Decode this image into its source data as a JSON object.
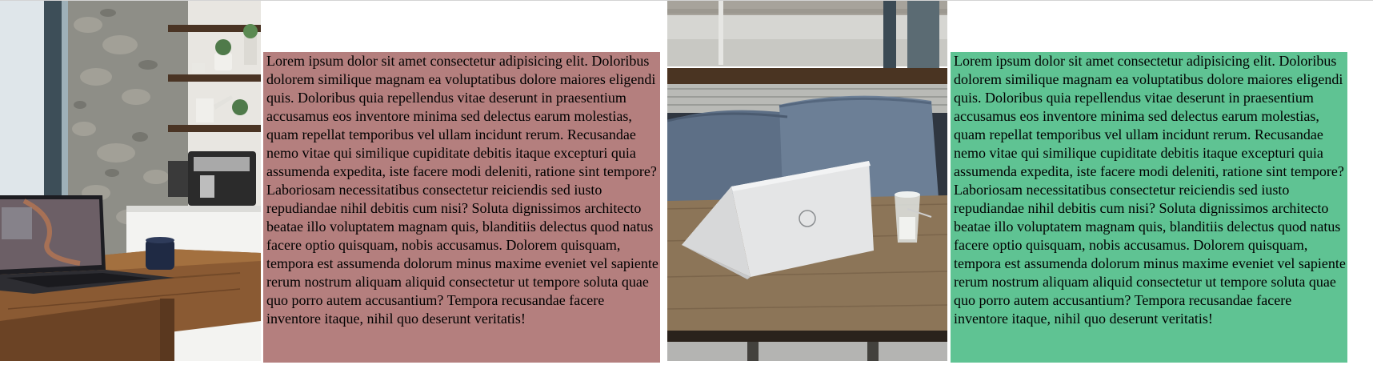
{
  "colors": {
    "block_1_background": "#b47f7e",
    "block_2_background": "#5fc393",
    "top_rule": "#d4d4d4"
  },
  "images": [
    {
      "description_icon": "laptop-coffee-kitchen-photo"
    },
    {
      "description_icon": "laptop-cafe-table-photo"
    }
  ],
  "text_blocks": [
    {
      "text": "Lorem ipsum dolor sit amet consectetur adipisicing elit. Doloribus dolorem similique magnam ea voluptatibus dolore maiores eligendi quis. Doloribus quia repellendus vitae deserunt in praesentium accusamus eos inventore minima sed delectus earum molestias, quam repellat temporibus vel ullam incidunt rerum. Recusandae nemo vitae qui similique cupiditate debitis itaque excepturi quia assumenda expedita, iste facere modi deleniti, ratione sint tempore? Laboriosam necessitatibus consectetur reiciendis sed iusto repudiandae nihil debitis cum nisi? Soluta dignissimos architecto beatae illo voluptatem magnam quis, blanditiis delectus quod natus facere optio quisquam, nobis accusamus. Dolorem quisquam, tempora est assumenda dolorum minus maxime eveniet vel sapiente rerum nostrum aliquam aliquid consectetur ut tempore soluta quae quo porro autem accusantium? Tempora recusandae facere inventore itaque, nihil quo deserunt veritatis!"
    },
    {
      "text": "Lorem ipsum dolor sit amet consectetur adipisicing elit. Doloribus dolorem similique magnam ea voluptatibus dolore maiores eligendi quis. Doloribus quia repellendus vitae deserunt in praesentium accusamus eos inventore minima sed delectus earum molestias, quam repellat temporibus vel ullam incidunt rerum. Recusandae nemo vitae qui similique cupiditate debitis itaque excepturi quia assumenda expedita, iste facere modi deleniti, ratione sint tempore? Laboriosam necessitatibus consectetur reiciendis sed iusto repudiandae nihil debitis cum nisi? Soluta dignissimos architecto beatae illo voluptatem magnam quis, blanditiis delectus quod natus facere optio quisquam, nobis accusamus. Dolorem quisquam, tempora est assumenda dolorum minus maxime eveniet vel sapiente rerum nostrum aliquam aliquid consectetur ut tempore soluta quae quo porro autem accusantium? Tempora recusandae facere inventore itaque, nihil quo deserunt veritatis!"
    }
  ]
}
